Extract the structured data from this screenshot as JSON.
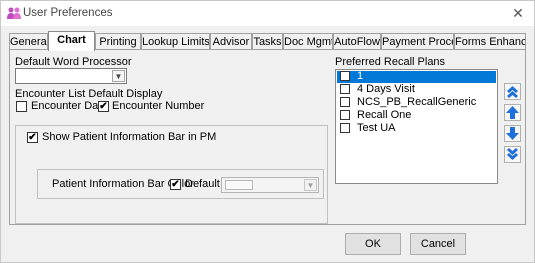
{
  "window": {
    "title": "User Preferences",
    "close_glyph": "✕"
  },
  "tabs": [
    {
      "label": "General",
      "active": false
    },
    {
      "label": "Chart",
      "active": true
    },
    {
      "label": "Printing",
      "active": false
    },
    {
      "label": "Lookup Limits",
      "active": false
    },
    {
      "label": "Advisor",
      "active": false
    },
    {
      "label": "Tasks",
      "active": false
    },
    {
      "label": "Doc Mgmt",
      "active": false
    },
    {
      "label": "AutoFlow",
      "active": false
    },
    {
      "label": "Payment Proce...",
      "active": false
    },
    {
      "label": "Forms Enhanc...",
      "active": false
    }
  ],
  "chart": {
    "word_processor_label": "Default Word Processor",
    "word_processor_value": "",
    "encounter_display_label": "Encounter List Default Display",
    "encounter_date_label": "Encounter Date",
    "encounter_date_checked": false,
    "encounter_number_label": "Encounter Number",
    "encounter_number_checked": true,
    "show_patient_info_label": "Show Patient Information Bar in PM",
    "show_patient_info_checked": true,
    "info_bar_color_label": "Patient Information Bar Color",
    "default_label": "Default",
    "default_checked": true,
    "color_value": "",
    "recall_plans_label": "Preferred Recall Plans",
    "recall_plans": [
      {
        "label": "1",
        "checked": false,
        "selected": true
      },
      {
        "label": "4 Days Visit",
        "checked": false,
        "selected": false
      },
      {
        "label": "NCS_PB_RecallGeneric",
        "checked": false,
        "selected": false
      },
      {
        "label": "Recall One",
        "checked": false,
        "selected": false
      },
      {
        "label": "Test UA",
        "checked": false,
        "selected": false
      }
    ],
    "check_glyph": "✔"
  },
  "icons": {
    "move_top": "double-up-arrow-icon",
    "move_up": "up-arrow-icon",
    "move_down": "down-arrow-icon",
    "move_bottom": "double-down-arrow-icon"
  },
  "colors": {
    "selection": "#0078d7",
    "arrow_blue": "#1e6fd9"
  },
  "buttons": {
    "ok": "OK",
    "cancel": "Cancel"
  }
}
